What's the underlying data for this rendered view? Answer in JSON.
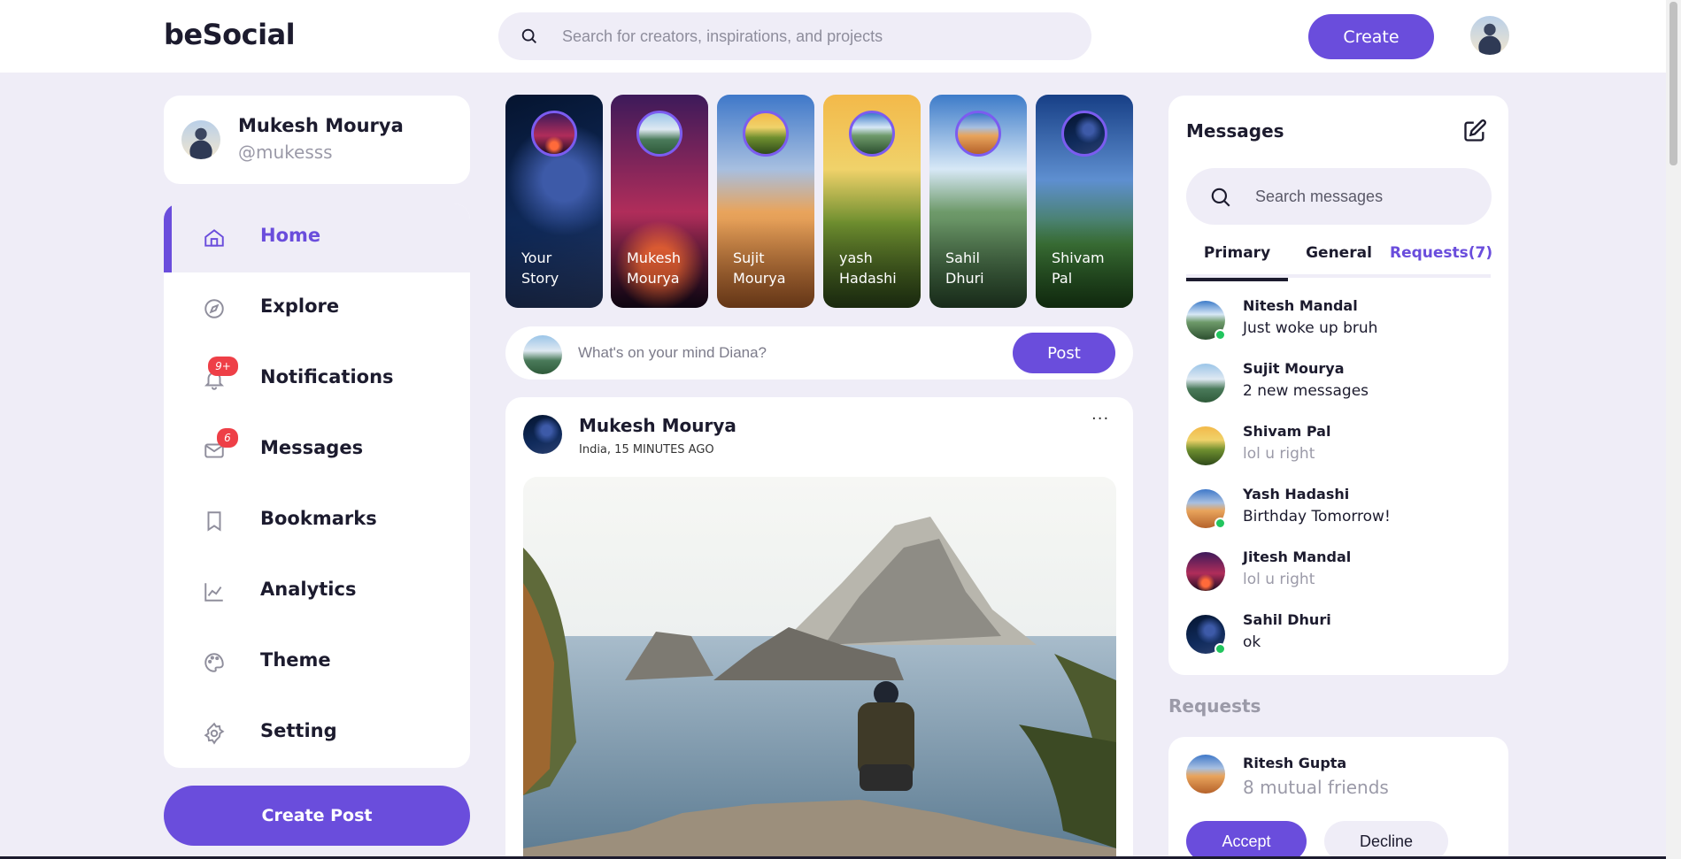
{
  "brand": {
    "logo": "beSocial",
    "accent": "#6a4ddc"
  },
  "search": {
    "placeholder": "Search for creators, inspirations, and projects"
  },
  "header": {
    "create_label": "Create"
  },
  "profile": {
    "name": "Mukesh Mourya",
    "handle": "@mukesss"
  },
  "sidebar": {
    "items": [
      {
        "label": "Home",
        "icon": "home-icon",
        "active": true
      },
      {
        "label": "Explore",
        "icon": "compass-icon"
      },
      {
        "label": "Notifications",
        "icon": "bell-icon",
        "badge": "9+"
      },
      {
        "label": "Messages",
        "icon": "mail-icon",
        "badge": "6"
      },
      {
        "label": "Bookmarks",
        "icon": "bookmark-icon"
      },
      {
        "label": "Analytics",
        "icon": "chart-line-icon"
      },
      {
        "label": "Theme",
        "icon": "palette-icon"
      },
      {
        "label": "Setting",
        "icon": "gear-icon"
      }
    ],
    "create_post_label": "Create Post"
  },
  "stories": [
    {
      "line1": "Your",
      "line2": "Story"
    },
    {
      "line1": "Mukesh",
      "line2": "Mourya"
    },
    {
      "line1": "Sujit",
      "line2": "Mourya"
    },
    {
      "line1": "yash",
      "line2": "Hadashi"
    },
    {
      "line1": "Sahil",
      "line2": "Dhuri"
    },
    {
      "line1": "Shivam",
      "line2": "Pal"
    }
  ],
  "composer": {
    "placeholder": "What's on your mind Diana?",
    "post_label": "Post"
  },
  "post": {
    "author": "Mukesh Mourya",
    "meta": "India, 15 MINUTES AGO",
    "more": "···"
  },
  "messages": {
    "title": "Messages",
    "search_placeholder": "Search messages",
    "tabs": [
      "Primary",
      "General",
      "Requests(7)"
    ],
    "items": [
      {
        "name": "Nitesh Mandal",
        "text": "Just woke up bruh",
        "online": true
      },
      {
        "name": "Sujit Mourya",
        "text": "2 new messages",
        "online": false
      },
      {
        "name": "Shivam Pal",
        "text": "lol u right",
        "online": false
      },
      {
        "name": "Yash Hadashi",
        "text": "Birthday Tomorrow!",
        "online": true
      },
      {
        "name": "Jitesh Mandal",
        "text": "lol u right",
        "online": false
      },
      {
        "name": "Sahil Dhuri",
        "text": "ok",
        "online": true
      }
    ]
  },
  "requests": {
    "heading": "Requests",
    "item": {
      "name": "Ritesh Gupta",
      "mutual": "8 mutual friends",
      "accept_label": "Accept",
      "decline_label": "Decline"
    }
  }
}
